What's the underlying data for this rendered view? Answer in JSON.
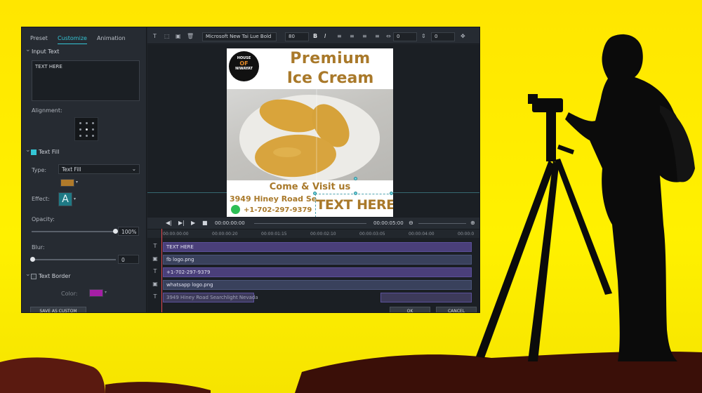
{
  "panel": {
    "tabs": [
      "Preset",
      "Customize",
      "Animation"
    ],
    "active_tab": "Customize",
    "input_text_header": "Input Text",
    "input_text_value": "TEXT HERE",
    "alignment_label": "Alignment:",
    "text_fill_header": "Text Fill",
    "type_label": "Type:",
    "type_value": "Text Fill",
    "fill_color": "#b07a2a",
    "effect_label": "Effect:",
    "effect_glyph": "A",
    "opacity_label": "Opacity:",
    "opacity_value": "100%",
    "opacity_fraction": 1.0,
    "blur_label": "Blur:",
    "blur_value": "0",
    "text_border_header": "Text Border",
    "color_label": "Color:",
    "border_color": "#a61ea6",
    "save_custom": "SAVE AS CUSTOM"
  },
  "toolbar": {
    "font": "Microsoft New Tai Lue Bold",
    "size": "80",
    "bold": "B",
    "italic": "I",
    "spacing1": "0",
    "spacing2": "0"
  },
  "poster": {
    "logo_top": "HOUSE",
    "logo_mid": "OF",
    "logo_bottom": "NIWAYAT",
    "title_line1": "Premium",
    "title_line2": "Ice Cream",
    "come_visit": "Come & Visit us",
    "address": "3949 Hiney Road Se",
    "phone": "+1-702-297-9379",
    "overlay_text": "TEXT HERE",
    "accent": "#a9792a"
  },
  "transport": {
    "current_time": "00:00:00:00",
    "total_time": "00:00:05:00"
  },
  "timeline": {
    "ruler": [
      "00:00:00:00",
      "00:00:00:20",
      "00:00:01:15",
      "00:00:02:10",
      "00:00:03:05",
      "00:00:04:00",
      "00:00:0"
    ],
    "tracks": [
      {
        "icon": "T",
        "label": "TEXT HERE",
        "kind": "text"
      },
      {
        "icon": "▣",
        "label": "fb logo.png",
        "kind": "image"
      },
      {
        "icon": "T",
        "label": "+1-702-297-9379",
        "kind": "text"
      },
      {
        "icon": "▣",
        "label": "whatsapp logo.png",
        "kind": "image"
      },
      {
        "icon": "T",
        "label": "3949 Hiney Road Searchlight Nevada",
        "kind": "text"
      }
    ]
  },
  "dialog_buttons": {
    "ok": "OK",
    "cancel": "CANCEL"
  },
  "colors": {
    "background_yellow": "#ffe600",
    "editor_dark": "#1f2329",
    "accent_teal": "#34c6d6"
  }
}
